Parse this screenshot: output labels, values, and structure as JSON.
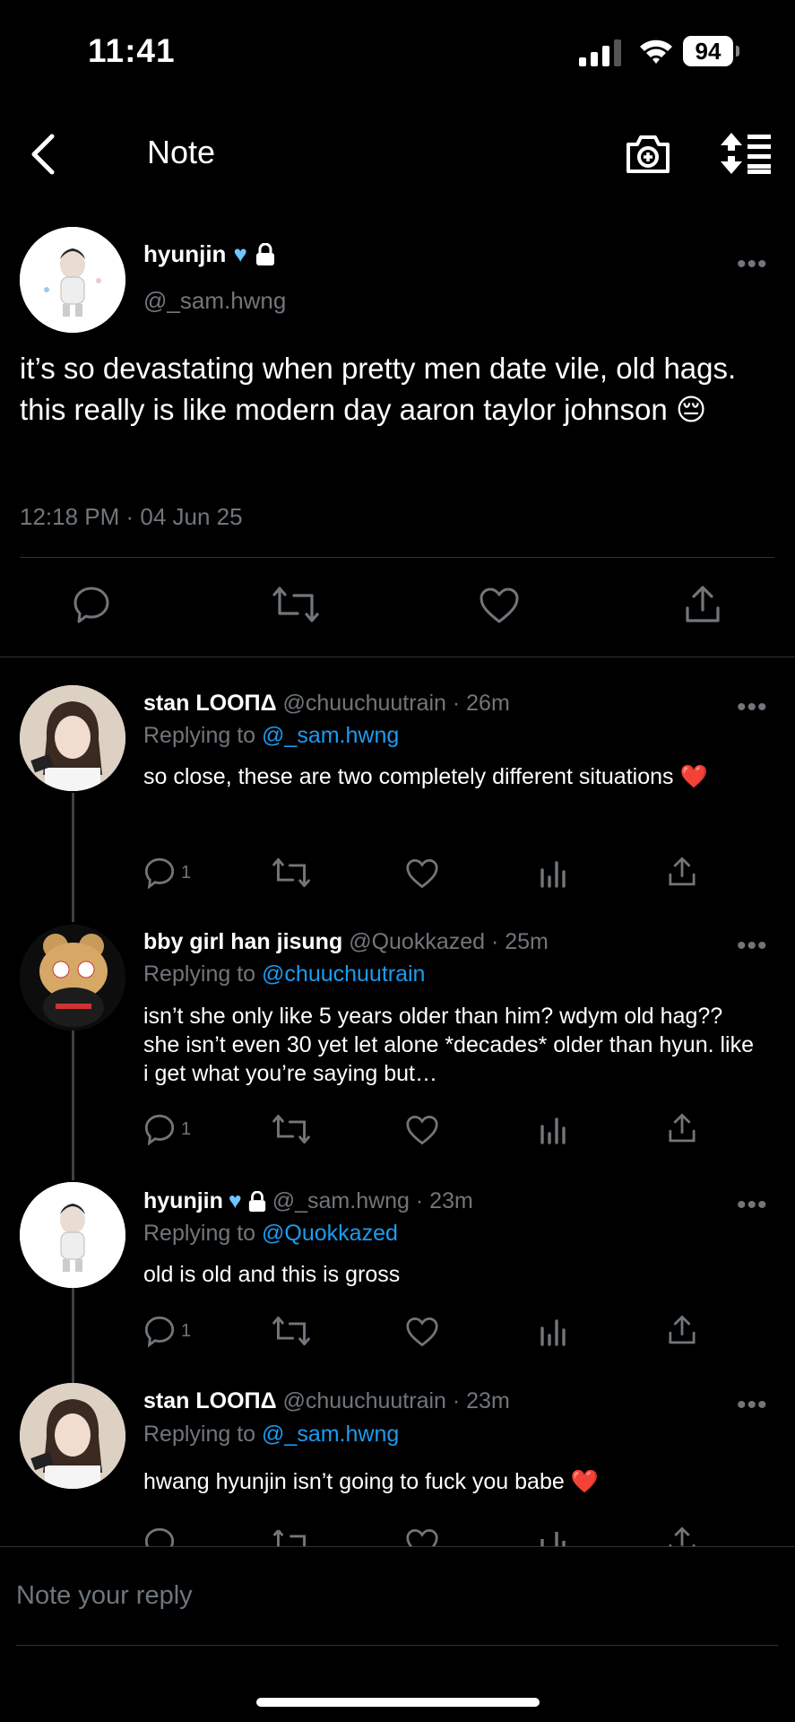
{
  "status": {
    "time": "11:41",
    "battery": "94"
  },
  "header": {
    "title": "Note"
  },
  "main_post": {
    "name": "hyunjin",
    "handle": "@_sam.hwng",
    "text": "it’s so devastating when pretty men date vile, old hags. this really is like modern day aaron taylor johnson 😔",
    "timestamp": "12:18 PM · 04 Jun 25"
  },
  "replies": [
    {
      "name": "stan LOOΠΔ",
      "meta": "@chuuchuutrain · 26m",
      "replying_label": "Replying to",
      "replying_to": "@_sam.hwng",
      "text": "so close, these are two completely different situations ❤️",
      "reply_count": "1"
    },
    {
      "name": "bby girl han jisung",
      "meta": "@Quokkazed · 25m",
      "replying_label": "Replying to",
      "replying_to": "@chuuchuutrain",
      "text": "isn’t she only like 5 years older than him? wdym old hag?? she isn’t even 30 yet let alone *decades* older than hyun. like i get what you’re saying but…",
      "reply_count": "1"
    },
    {
      "name": "hyunjin",
      "meta": "@_sam.hwng · 23m",
      "replying_label": "Replying to",
      "replying_to": "@Quokkazed",
      "text": "old is old and this is gross",
      "reply_count": "1"
    },
    {
      "name": "stan LOOΠΔ",
      "meta": "@chuuchuutrain · 23m",
      "replying_label": "Replying to",
      "replying_to": "@_sam.hwng",
      "text": "hwang hyunjin isn’t going to fuck you babe ❤️",
      "reply_count": ""
    }
  ],
  "composer": {
    "placeholder": "Note your reply"
  },
  "colors": {
    "accent": "#1d9bf0",
    "muted": "#71767b",
    "verified": "#6ec6ff",
    "background": "#000000"
  }
}
